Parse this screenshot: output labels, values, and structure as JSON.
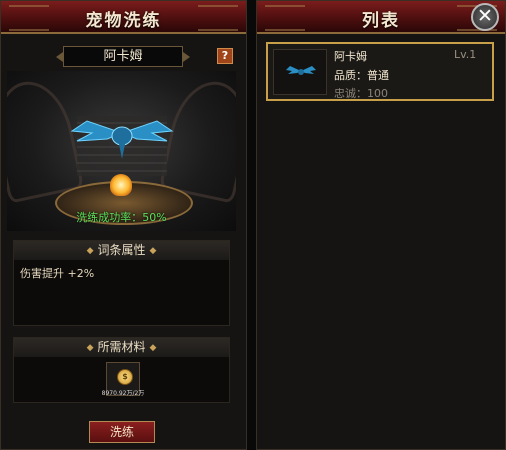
{
  "left_panel": {
    "title": "宠物洗练",
    "pet_name": "阿卡姆",
    "help": "?",
    "success_rate": "洗练成功率：50%",
    "attributes": {
      "header": "词条属性",
      "line": "伤害提升 +2%"
    },
    "materials": {
      "header": "所需材料",
      "item_icon": "gold-coin-icon",
      "count": "8970.92万/2万"
    },
    "refine_button": "洗练"
  },
  "right_panel": {
    "title": "列表",
    "close": "✕",
    "pets": [
      {
        "name": "阿卡姆",
        "level": "Lv.1",
        "quality_label": "品质：",
        "quality": "普通",
        "loyalty_label": "忠诚：",
        "loyalty": "100"
      }
    ]
  },
  "colors": {
    "title_red": "#6a1616",
    "gold_border": "#c9a04a",
    "success_green": "#5be05b"
  }
}
